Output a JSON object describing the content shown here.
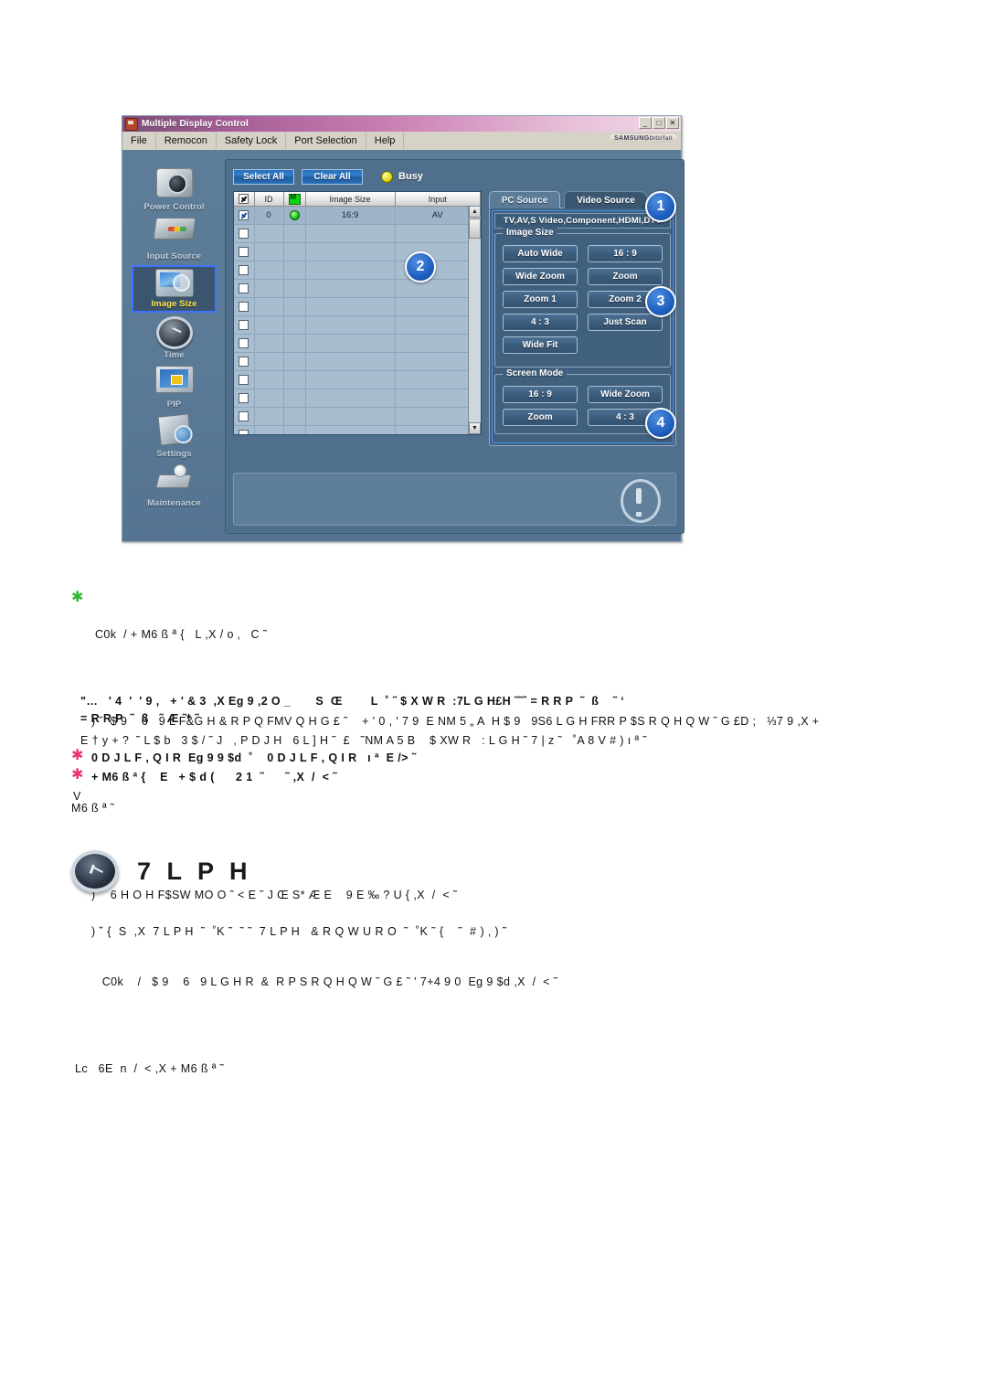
{
  "window": {
    "title": "Multiple Display Control",
    "titlebar_icon": "app-icon",
    "minimize": "_",
    "maximize": "□",
    "close": "✕",
    "brand": "SAMSUNG",
    "brand_suffix": "DIGITall",
    "menu": [
      "File",
      "Remocon",
      "Safety Lock",
      "Port Selection",
      "Help"
    ]
  },
  "sidebar": {
    "items": [
      {
        "label": "Power Control",
        "icon": "power-control-icon",
        "active": false
      },
      {
        "label": "Input Source",
        "icon": "input-source-icon",
        "active": false
      },
      {
        "label": "Image Size",
        "icon": "image-size-icon",
        "active": true
      },
      {
        "label": "Time",
        "icon": "time-icon",
        "active": false
      },
      {
        "label": "PIP",
        "icon": "pip-icon",
        "active": false
      },
      {
        "label": "Settings",
        "icon": "settings-icon",
        "active": false
      },
      {
        "label": "Maintenance",
        "icon": "maintenance-icon",
        "active": false
      }
    ]
  },
  "toolbar": {
    "select_all": "Select All",
    "clear_all": "Clear All",
    "status_label": "Busy",
    "status_color": "#d8d200"
  },
  "table": {
    "headers": [
      "",
      "ID",
      "",
      "Image Size",
      "Input"
    ],
    "header_icons": [
      "header-checkbox",
      "",
      "monitor-status-icon",
      "",
      ""
    ],
    "rows": [
      {
        "checked": true,
        "id": "0",
        "status": "online",
        "image_size": "16:9",
        "input": "AV"
      },
      {
        "checked": false,
        "id": "",
        "status": "",
        "image_size": "",
        "input": ""
      },
      {
        "checked": false,
        "id": "",
        "status": "",
        "image_size": "",
        "input": ""
      },
      {
        "checked": false,
        "id": "",
        "status": "",
        "image_size": "",
        "input": ""
      },
      {
        "checked": false,
        "id": "",
        "status": "",
        "image_size": "",
        "input": ""
      },
      {
        "checked": false,
        "id": "",
        "status": "",
        "image_size": "",
        "input": ""
      },
      {
        "checked": false,
        "id": "",
        "status": "",
        "image_size": "",
        "input": ""
      },
      {
        "checked": false,
        "id": "",
        "status": "",
        "image_size": "",
        "input": ""
      },
      {
        "checked": false,
        "id": "",
        "status": "",
        "image_size": "",
        "input": ""
      },
      {
        "checked": false,
        "id": "",
        "status": "",
        "image_size": "",
        "input": ""
      },
      {
        "checked": false,
        "id": "",
        "status": "",
        "image_size": "",
        "input": ""
      },
      {
        "checked": false,
        "id": "",
        "status": "",
        "image_size": "",
        "input": ""
      },
      {
        "checked": false,
        "id": "",
        "status": "",
        "image_size": "",
        "input": ""
      }
    ],
    "scroll_up": "▲",
    "scroll_down": "▼"
  },
  "control_panel": {
    "tabs": [
      {
        "label": "PC Source",
        "active": true
      },
      {
        "label": "Video Source",
        "active": false
      }
    ],
    "source_strip": "TV,AV,S Video,Component,HDMI,DTV",
    "groups": [
      {
        "title": "Image Size",
        "rows": [
          [
            "Auto Wide",
            "16 : 9"
          ],
          [
            "Wide Zoom",
            "Zoom"
          ],
          [
            "Zoom 1",
            "Zoom 2"
          ],
          [
            "4 : 3",
            "Just Scan"
          ],
          [
            "Wide Fit",
            ""
          ]
        ]
      },
      {
        "title": "Screen Mode",
        "rows": [
          [
            "16 : 9",
            "Wide Zoom"
          ],
          [
            "Zoom",
            "4 : 3"
          ]
        ]
      }
    ]
  },
  "callouts": [
    {
      "number": "1"
    },
    {
      "number": "2"
    },
    {
      "number": "3"
    },
    {
      "number": "4"
    }
  ],
  "document": {
    "block1": {
      "marker": "✱",
      "marker_color": "#2eb82e",
      "line1": "C0k  / + M6 ß ª {   L ,X / o ‚   C ˜",
      "line2": ") ˘  $ 9    6   9 L F&G H & R P Q FMV Q H G £ ˜    + ' 0 , ' 7 9  E NM 5 „ A  H $ 9   9S6 L G H FRR P $S R Q H Q W ˜ G £D ;   ⅓7 9 ,X +",
      "line3": "M6 ß ª ˜",
      "line4": ") ˘  6 H O H F$SW MO O ˜ < E ˜ J Œ S* Æ E    9 E ‰ ? U { ,X  /  < ˜",
      "line5": "  C0k    /   $ 9    6   9 L G H R  &  R P S R Q H Q W ˜ G £ ˜ ' 7+4 9 0  Eg 9 $d ,X  /  < ˜",
      "line6": "Lc   6E  n  /  < ,X + M6 ß ª ˜"
    },
    "block2": {
      "line1": "\"…   ' 4  '  ' 9 ,   + ' & 3  ,X Eg 9 ‚2 O _       S  Œ        L  ˚ ˜ $ X W R  :7L G H£H ˜˜ˆ = R R P  ˜  ß    ˜ ‘",
      "line2": "= R R P  ˜  ß   ˜ Æ ˜* ˜",
      "line3": "E † y + ?  ˜ L $ b   3 $ / ˜ J   , P D J H   6 L ] H ˜  £   ˜NM A 5 B    $ XW R   : L G H ˜ 7 | z ˜   ˚A 8 V # ) ı ª ˜"
    },
    "block3": {
      "marker": "✱",
      "marker_color": "#e8356d",
      "line1": "0 D J L F , Q I R  Eg 9 9 $d  ˚    0 D J L F , Q I R   ı ª  E /> ˜"
    },
    "block4": {
      "marker": "✱",
      "marker_color": "#e8356d",
      "line1": "+ M6 ß ª {    E   + $ d (      2 1  ˜      ˜ ,X  /  < ˜"
    },
    "block5": {
      "line1": "V"
    },
    "time_section": {
      "icon": "time-icon",
      "title": "7 L P H",
      "note": ") ˘ {  S  ,X  7 L P H  ˜  ˚K ˜  ˜ ˜  7 L P H   & R Q W U R O  ˜  ˚K ˜ {    ˜  # ) ‚ ) ˜"
    }
  }
}
